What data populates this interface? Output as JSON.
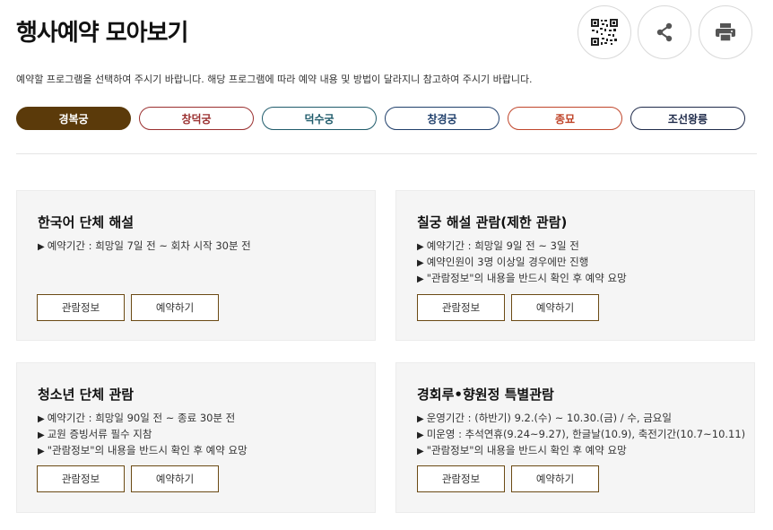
{
  "header": {
    "title": "행사예약 모아보기",
    "qr_icon": "qr-code-icon",
    "share_icon": "share-icon",
    "print_icon": "printer-icon"
  },
  "intro": "예약할 프로그램을 선택하여 주시기 바랍니다. 해당 프로그램에 따라 예약 내용 및 방법이 달라지니 참고하여 주시기 바랍니다.",
  "palace_tabs": [
    {
      "label": "경복궁",
      "color": "#5b3a0a",
      "active": true
    },
    {
      "label": "창덕궁",
      "color": "#9a2f2f",
      "active": false
    },
    {
      "label": "덕수궁",
      "color": "#1f5b6b",
      "active": false
    },
    {
      "label": "창경궁",
      "color": "#1f3f6b",
      "active": false
    },
    {
      "label": "종묘",
      "color": "#c0452a",
      "active": false
    },
    {
      "label": "조선왕릉",
      "color": "#1e2a4a",
      "active": false
    }
  ],
  "programs": [
    {
      "title": "한국어 단체 해설",
      "lines": [
        "예약기간 : 희망일 7일 전 ~ 회차 시작 30분 전"
      ],
      "info_label": "관람정보",
      "reserve_label": "예약하기"
    },
    {
      "title": "칠궁 해설 관람(제한 관람)",
      "lines": [
        "예약기간 : 희망일 9일 전 ~ 3일 전",
        "예약인원이 3명 이상일 경우에만 진행",
        "\"관람정보\"의 내용을 반드시 확인 후 예약 요망"
      ],
      "info_label": "관람정보",
      "reserve_label": "예약하기"
    },
    {
      "title": "청소년 단체 관람",
      "lines": [
        "예약기간 : 희망일 90일 전 ~ 종료 30분 전",
        "교원 증빙서류 필수 지참",
        "\"관람정보\"의 내용을 반드시 확인 후 예약 요망"
      ],
      "info_label": "관람정보",
      "reserve_label": "예약하기"
    },
    {
      "title": "경회루•향원정 특별관람",
      "lines": [
        "운영기간 : (하반기) 9.2.(수) ~ 10.30.(금) / 수, 금요일",
        "미운영 : 추석연휴(9.24~9.27), 한글날(10.9), 축전기간(10.7~10.11)",
        "\"관람정보\"의 내용을 반드시 확인 후 예약 요망"
      ],
      "info_label": "관람정보",
      "reserve_label": "예약하기"
    }
  ],
  "colors": {
    "accent_brown": "#5b3a0a",
    "button_border": "#6b4a14",
    "card_bg": "#f5f5f5"
  }
}
